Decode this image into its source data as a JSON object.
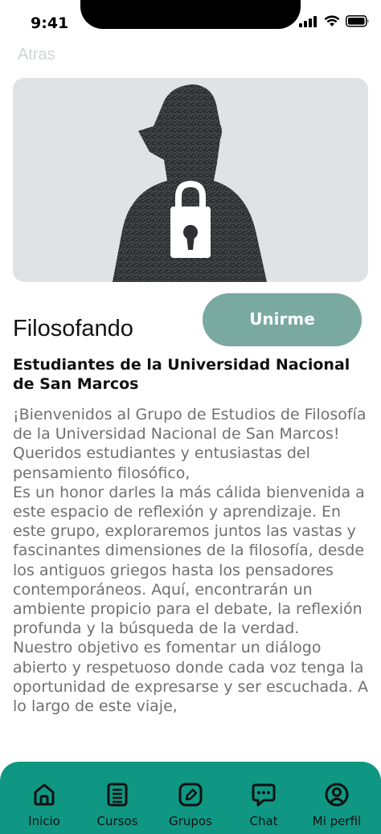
{
  "status_bar": {
    "time": "9:41"
  },
  "header": {
    "back_label": "Atras"
  },
  "hero": {
    "image_icon": "locked-person-illustration"
  },
  "group": {
    "title": "Filosofando",
    "join_label": "Unirme",
    "subtitle": "Estudiantes de la Universidad Nacional de San Marcos",
    "description": "¡Bienvenidos al Grupo de Estudios de Filosofía de la Universidad Nacional de San Marcos!\nQueridos estudiantes y entusiastas del pensamiento filosófico,\nEs un honor darles la más cálida bienvenida a este espacio de reflexión y aprendizaje. En este grupo, exploraremos juntos las vastas y fascinantes dimensiones de la filosofía, desde los antiguos griegos hasta los pensadores contemporáneos. Aquí, encontrarán un ambiente propicio para el debate, la reflexión profunda y la búsqueda de la verdad.\nNuestro objetivo es fomentar un diálogo abierto y respetuoso donde cada voz tenga la oportunidad de expresarse y ser escuchada. A lo largo de este viaje,"
  },
  "tabs": [
    {
      "label": "Inicio",
      "icon": "home-icon"
    },
    {
      "label": "Cursos",
      "icon": "book-icon"
    },
    {
      "label": "Grupos",
      "icon": "edit-icon"
    },
    {
      "label": "Chat",
      "icon": "chat-icon"
    },
    {
      "label": "Mi perfil",
      "icon": "profile-icon"
    }
  ],
  "colors": {
    "accent": "#0f9783",
    "button": "#79a9a1",
    "hero_bg": "#e1e2e6"
  }
}
